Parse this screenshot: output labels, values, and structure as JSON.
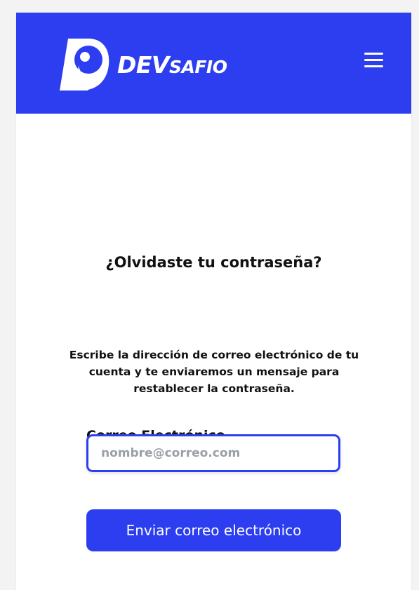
{
  "header": {
    "logo_text_primary": "DEV",
    "logo_text_secondary": "SAFIO",
    "menu_icon": "hamburger-menu-icon",
    "background_color": "#2c3ef0"
  },
  "main": {
    "title": "¿Olvidaste tu contraseña?",
    "description": "Escribe la dirección de correo electrónico de tu cuenta y te enviaremos un mensaje para restablecer la contraseña.",
    "email_label": "Correo Electrónico",
    "email_value": "",
    "email_placeholder": "nombre@correo.com",
    "submit_label": "Enviar correo electrónico"
  }
}
